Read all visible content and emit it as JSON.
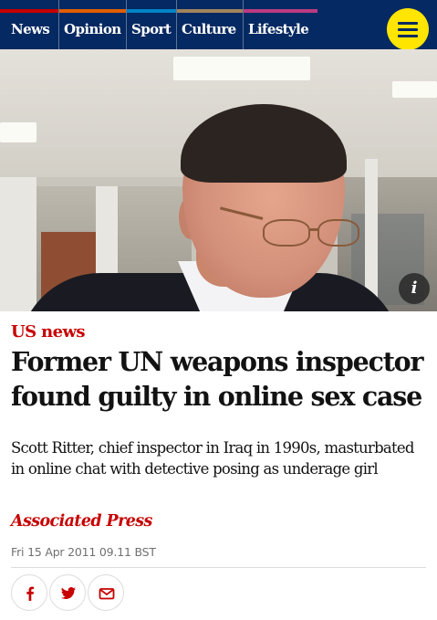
{
  "nav": {
    "items": [
      {
        "label": "News",
        "accent": "#c70000"
      },
      {
        "label": "Opinion",
        "accent": "#e05e00"
      },
      {
        "label": "Sport",
        "accent": "#0084c6"
      },
      {
        "label": "Culture",
        "accent": "#a1845c"
      },
      {
        "label": "Lifestyle",
        "accent": "#bb3b80"
      }
    ],
    "menu_icon": "hamburger-menu-icon",
    "background": "#052962",
    "menu_button_color": "#ffe500"
  },
  "photo": {
    "info_glyph": "i"
  },
  "article": {
    "kicker": "US news",
    "headline": "Former UN weapons inspector found guilty in online sex case",
    "standfirst": "Scott Ritter, chief inspector in Iraq in 1990s, masturbated in online chat with detective posing as underage girl",
    "byline": "Associated Press",
    "date": "Fri 15 Apr 2011 09.11 BST",
    "accent": "#c70000"
  },
  "share": {
    "buttons": [
      {
        "icon": "facebook-icon"
      },
      {
        "icon": "twitter-icon"
      },
      {
        "icon": "email-icon"
      }
    ]
  }
}
